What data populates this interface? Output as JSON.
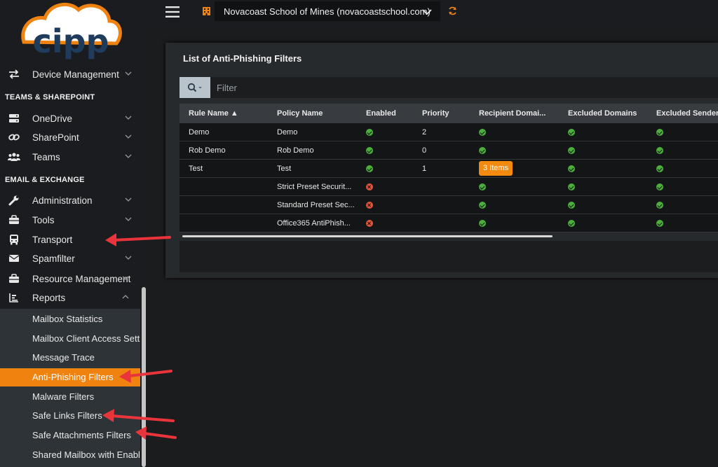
{
  "logo": {
    "text": "cipp"
  },
  "sidebar": {
    "top_item": {
      "label": "Device Management"
    },
    "sections": [
      {
        "title": "TEAMS & SHAREPOINT"
      },
      {
        "title": "EMAIL & EXCHANGE"
      }
    ],
    "items": [
      {
        "label": "OneDrive"
      },
      {
        "label": "SharePoint"
      },
      {
        "label": "Teams"
      },
      {
        "label": "Administration"
      },
      {
        "label": "Tools"
      },
      {
        "label": "Transport"
      },
      {
        "label": "Spamfilter"
      },
      {
        "label": "Resource Management"
      },
      {
        "label": "Reports"
      }
    ],
    "report_items": [
      {
        "label": "Mailbox Statistics"
      },
      {
        "label": "Mailbox Client Access Settings"
      },
      {
        "label": "Message Trace"
      },
      {
        "label": "Anti-Phishing Filters"
      },
      {
        "label": "Malware Filters"
      },
      {
        "label": "Safe Links Filters"
      },
      {
        "label": "Safe Attachments Filters"
      },
      {
        "label": "Shared Mailbox with Enabled Account"
      }
    ]
  },
  "topbar": {
    "tenant": "Novacoast School of Mines (novacoastschool.com)"
  },
  "card": {
    "title": "List of Anti-Phishing Filters",
    "filter_placeholder": "Filter",
    "columns": [
      "Rule Name ▲",
      "Policy Name",
      "Enabled",
      "Priority",
      "Recipient Domai...",
      "Excluded Domains",
      "Excluded Senders"
    ],
    "rows": [
      {
        "rule": "Demo",
        "policy": "Demo",
        "enabled": true,
        "priority": "2",
        "recipient": "ok",
        "excl_domains": true,
        "excl_senders": true
      },
      {
        "rule": "Rob Demo",
        "policy": "Rob Demo",
        "enabled": true,
        "priority": "0",
        "recipient": "ok",
        "excl_domains": true,
        "excl_senders": true
      },
      {
        "rule": "Test",
        "policy": "Test",
        "enabled": true,
        "priority": "1",
        "recipient": "3 Items",
        "excl_domains": true,
        "excl_senders": true
      },
      {
        "rule": "",
        "policy": "Strict Preset Securit...",
        "enabled": false,
        "priority": "",
        "recipient": "ok",
        "excl_domains": true,
        "excl_senders": true
      },
      {
        "rule": "",
        "policy": "Standard Preset Sec...",
        "enabled": false,
        "priority": "",
        "recipient": "ok",
        "excl_domains": true,
        "excl_senders": true
      },
      {
        "rule": "",
        "policy": "Office365 AntiPhish...",
        "enabled": false,
        "priority": "",
        "recipient": "ok",
        "excl_domains": true,
        "excl_senders": true
      }
    ]
  },
  "colors": {
    "accent": "#f0820f",
    "ok": "#4caf3b",
    "error": "#e2553a",
    "arrow": "#e8343a"
  }
}
